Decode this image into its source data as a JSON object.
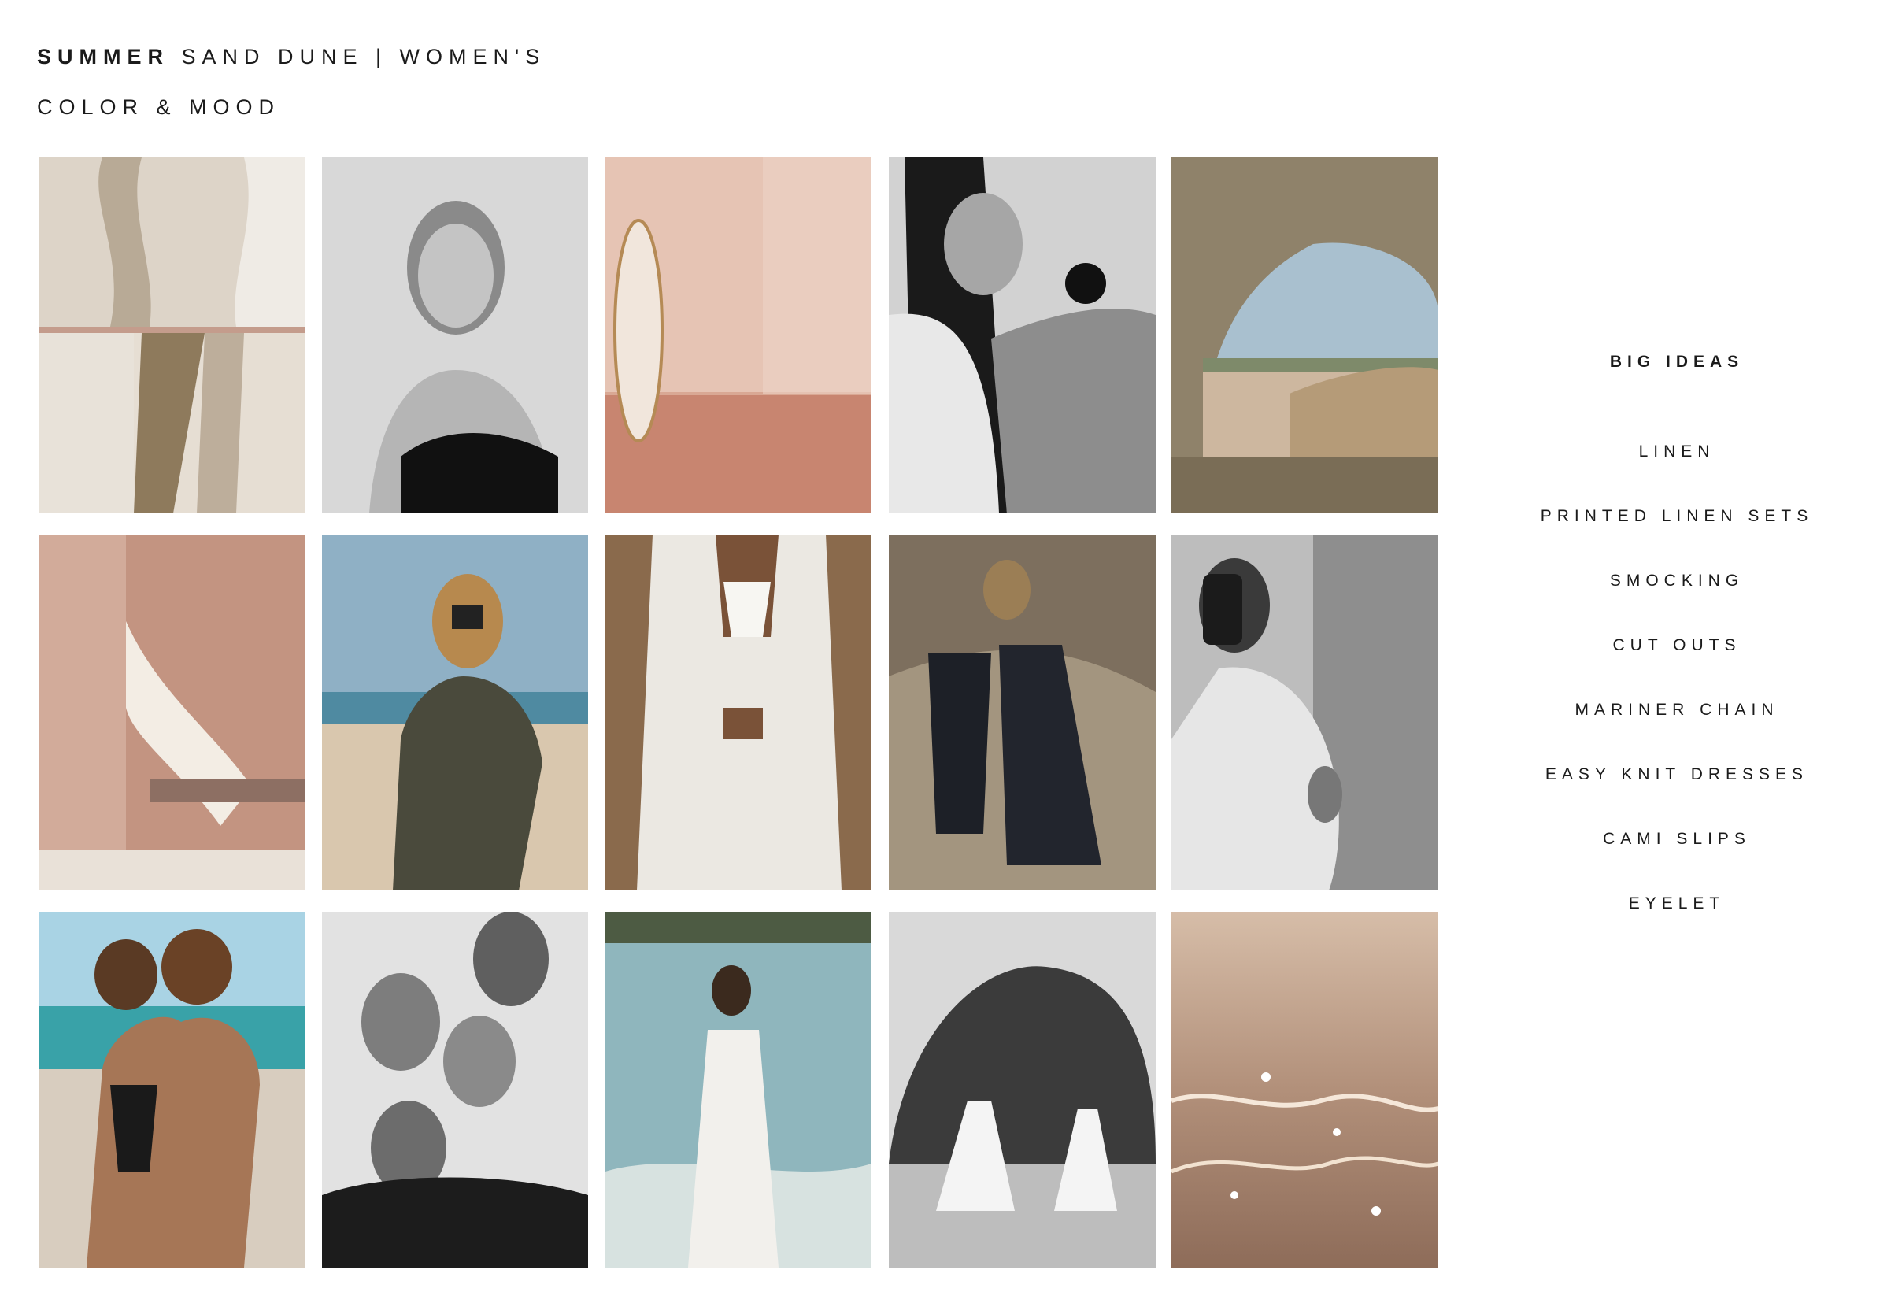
{
  "header": {
    "title_bold": "SUMMER",
    "title_rest": "SAND DUNE | WOMEN'S",
    "subtitle": "COLOR & MOOD"
  },
  "tiles": [
    {
      "name": "abstract-arch-collage-image",
      "palette": "#d9cfc2"
    },
    {
      "name": "bw-portrait-model-image",
      "palette": "#9a9a9a"
    },
    {
      "name": "pink-room-surfboard-image",
      "palette": "#e3bfae"
    },
    {
      "name": "bw-model-scrunchie-image",
      "palette": "#8c8c8c"
    },
    {
      "name": "desert-rock-arch-image",
      "palette": "#a89a7c"
    },
    {
      "name": "pink-wall-fabric-image",
      "palette": "#c69c8c"
    },
    {
      "name": "beach-camera-woman-image",
      "palette": "#a8bfcc"
    },
    {
      "name": "white-linen-shirt-image",
      "palette": "#c9c3ba"
    },
    {
      "name": "two-women-rocks-image",
      "palette": "#8a7c6c"
    },
    {
      "name": "bw-mirror-selfie-image",
      "palette": "#b0b0b0"
    },
    {
      "name": "two-women-hugging-beach-image",
      "palette": "#9fc3c4"
    },
    {
      "name": "bw-four-models-image",
      "palette": "#7a7a7a"
    },
    {
      "name": "woman-white-dress-sea-image",
      "palette": "#8fb3b8"
    },
    {
      "name": "bw-dancers-rock-image",
      "palette": "#9e9e9e"
    },
    {
      "name": "sparkling-water-image",
      "palette": "#b89b86"
    }
  ],
  "ideas": {
    "title": "BIG IDEAS",
    "items": [
      "LINEN",
      "PRINTED LINEN SETS",
      "SMOCKING",
      "CUT OUTS",
      "MARINER CHAIN",
      "EASY KNIT DRESSES",
      "CAMI SLIPS",
      "EYELET"
    ]
  }
}
